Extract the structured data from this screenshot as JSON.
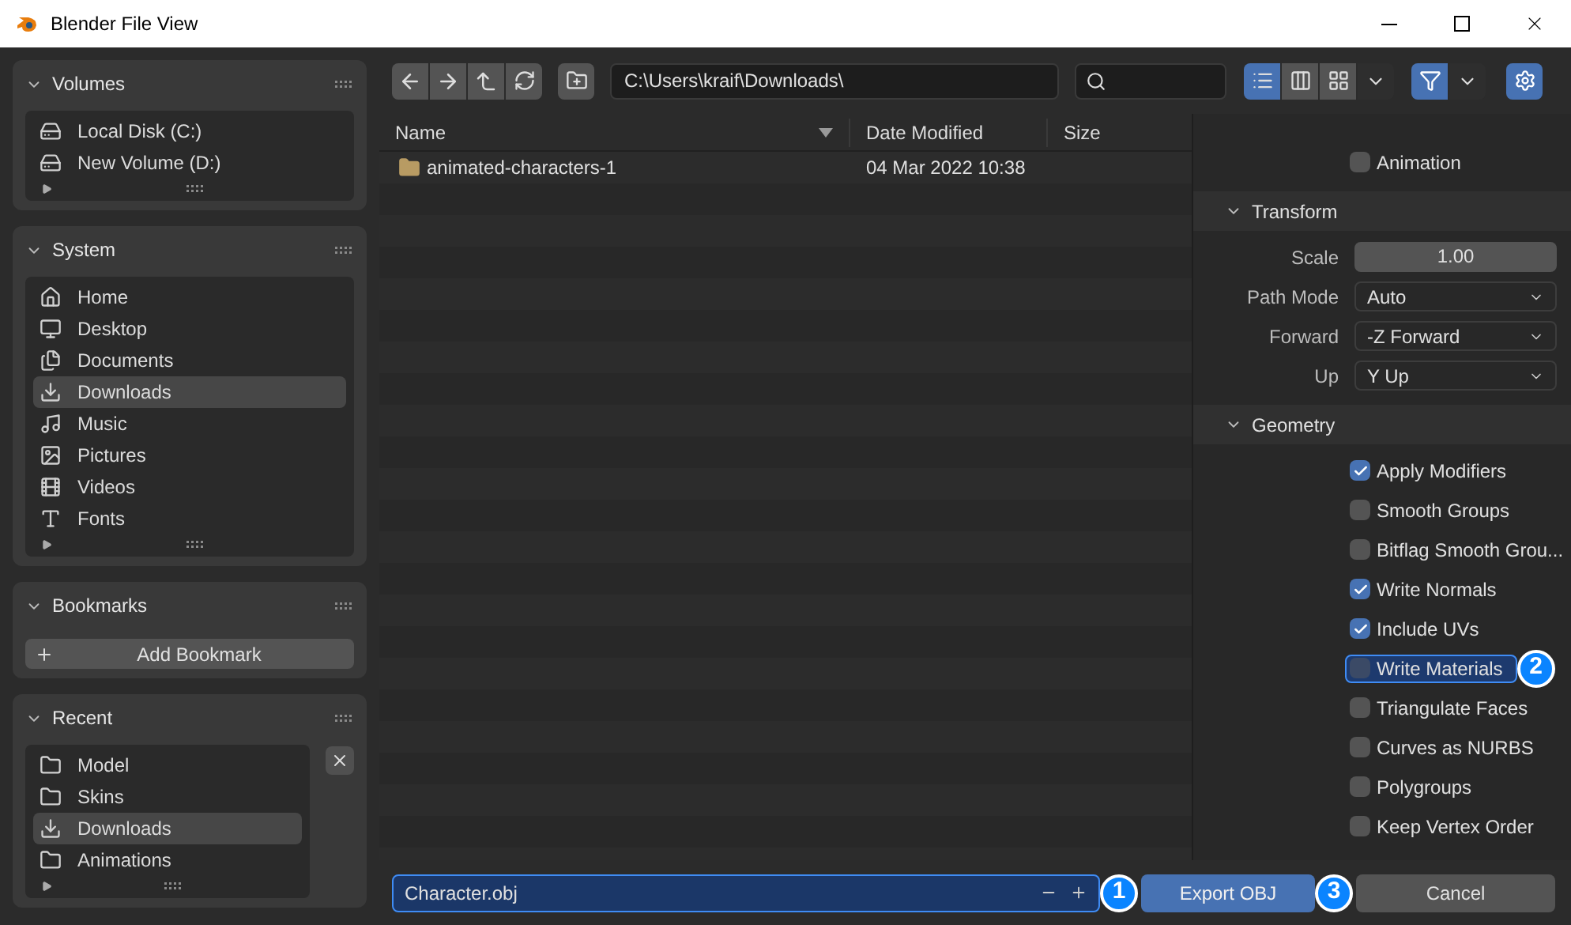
{
  "window": {
    "title": "Blender File View"
  },
  "sidebar": [
    {
      "title": "Volumes",
      "expanded": true,
      "kind": "volumes",
      "items": [
        {
          "label": "Local Disk (C:)",
          "selected": false
        },
        {
          "label": "New Volume (D:)",
          "selected": false
        }
      ]
    },
    {
      "title": "System",
      "expanded": true,
      "kind": "system",
      "items": [
        {
          "label": "Home",
          "selected": false
        },
        {
          "label": "Desktop",
          "selected": false
        },
        {
          "label": "Documents",
          "selected": false
        },
        {
          "label": "Downloads",
          "selected": true
        },
        {
          "label": "Music",
          "selected": false
        },
        {
          "label": "Pictures",
          "selected": false
        },
        {
          "label": "Videos",
          "selected": false
        },
        {
          "label": "Fonts",
          "selected": false
        }
      ]
    },
    {
      "title": "Bookmarks",
      "expanded": true,
      "kind": "bookmarks",
      "button": "Add Bookmark"
    },
    {
      "title": "Recent",
      "expanded": true,
      "kind": "recent",
      "items": [
        {
          "label": "Model",
          "selected": false
        },
        {
          "label": "Skins",
          "selected": false
        },
        {
          "label": "Downloads",
          "selected": true
        },
        {
          "label": "Animations",
          "selected": false
        }
      ]
    }
  ],
  "toolbar": {
    "path": "C:\\Users\\kraif\\Downloads\\",
    "view_modes": [
      {
        "selected": true
      },
      {
        "selected": false
      },
      {
        "selected": false
      }
    ],
    "filter_on": true
  },
  "table": {
    "columns": [
      "Name",
      "Date Modified",
      "Size"
    ],
    "rows": [
      {
        "name": "animated-characters-1",
        "date": "04 Mar 2022 10:38"
      }
    ]
  },
  "options": [
    {
      "kind": "checkbox",
      "label": "Animation",
      "checked": false,
      "focused": false
    },
    {
      "kind": "section",
      "label": "Transform",
      "expanded": true
    },
    {
      "kind": "number",
      "label": "Scale",
      "value": "1.00"
    },
    {
      "kind": "dropdown",
      "label": "Path Mode",
      "value": "Auto"
    },
    {
      "kind": "dropdown",
      "label": "Forward",
      "value": "-Z Forward"
    },
    {
      "kind": "dropdown",
      "label": "Up",
      "value": "Y Up"
    },
    {
      "kind": "section",
      "label": "Geometry",
      "expanded": true
    },
    {
      "kind": "checkbox",
      "label": "Apply Modifiers",
      "checked": true,
      "focused": false
    },
    {
      "kind": "checkbox",
      "label": "Smooth Groups",
      "checked": false,
      "focused": false
    },
    {
      "kind": "checkbox",
      "label": "Bitflag Smooth Grou...",
      "checked": false,
      "focused": false
    },
    {
      "kind": "checkbox",
      "label": "Write Normals",
      "checked": true,
      "focused": false
    },
    {
      "kind": "checkbox",
      "label": "Include UVs",
      "checked": true,
      "focused": false
    },
    {
      "kind": "checkbox",
      "label": "Write Materials",
      "checked": false,
      "focused": true,
      "callout": "2"
    },
    {
      "kind": "checkbox",
      "label": "Triangulate Faces",
      "checked": false,
      "focused": false
    },
    {
      "kind": "checkbox",
      "label": "Curves as NURBS",
      "checked": false,
      "focused": false
    },
    {
      "kind": "checkbox",
      "label": "Polygroups",
      "checked": false,
      "focused": false
    },
    {
      "kind": "checkbox",
      "label": "Keep Vertex Order",
      "checked": false,
      "focused": false
    }
  ],
  "footer": {
    "filename": "Character.obj",
    "filename_callout": "1",
    "export": "Export OBJ",
    "export_callout": "3",
    "cancel": "Cancel"
  }
}
